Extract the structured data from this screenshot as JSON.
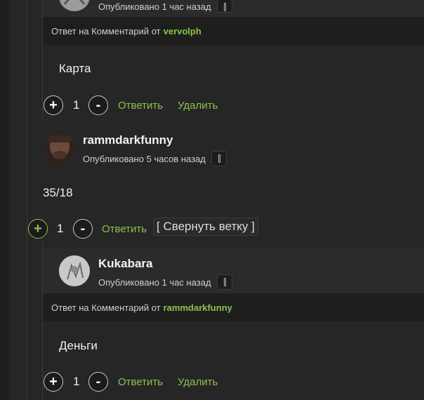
{
  "comments": [
    {
      "meta": "Опубликовано 1 час назад",
      "reply_prefix": "Ответ на Комментарий от",
      "reply_to": "vervolph",
      "text": "Карта",
      "votes": "1",
      "reply_label": "Ответить",
      "delete_label": "Удалить"
    },
    {
      "username": "rammdarkfunny",
      "meta": "Опубликовано 5 часов назад",
      "text": "35/18",
      "votes": "1",
      "reply_label": "Ответить",
      "collapse_label": "[ Свернуть ветку ]"
    },
    {
      "username": "Kukabara",
      "meta": "Опубликовано 1 час назад",
      "reply_prefix": "Ответ на Комментарий от",
      "reply_to": "rammdarkfunny",
      "text": "Деньги",
      "votes": "1",
      "reply_label": "Ответить",
      "delete_label": "Удалить"
    }
  ],
  "icons": {
    "plus": "+",
    "minus": "-"
  },
  "colors": {
    "accent": "#8bc34a",
    "background": "#262626",
    "reply_bar": "#1e1f1d"
  }
}
